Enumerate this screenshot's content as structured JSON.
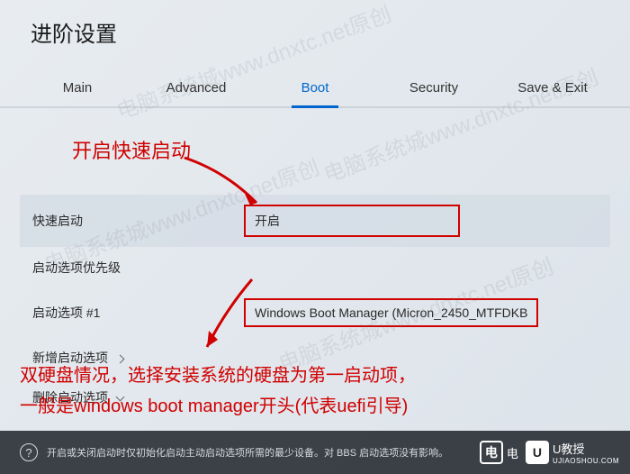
{
  "title": "进阶设置",
  "tabs": {
    "main": "Main",
    "advanced": "Advanced",
    "boot": "Boot",
    "security": "Security",
    "save_exit": "Save & Exit"
  },
  "annotations": {
    "top": "开启快速启动",
    "bottom_line1": "双硬盘情况，选择安装系统的硬盘为第一启动项，",
    "bottom_line2": "一般是windows boot manager开头(代表uefi引导)"
  },
  "settings": {
    "fast_boot": {
      "label": "快速启动",
      "value": "开启"
    },
    "boot_priority": {
      "label": "启动选项优先级"
    },
    "boot_option_1": {
      "label": "启动选项 #1",
      "value": "Windows Boot Manager (Micron_2450_MTFDKB"
    },
    "add_boot": {
      "label": "新增启动选项"
    },
    "delete_boot": {
      "label": "删除启动选项"
    }
  },
  "footer": {
    "help_text": "开启或关闭启动时仅初始化启动主动启动选项所需的最少设备。对 BBS 启动选项没有影响。"
  },
  "watermark": "电脑系统城www.dnxtc.net原创",
  "logos": {
    "left": {
      "icon": "电",
      "text": "电"
    },
    "right": {
      "icon": "U",
      "text": "U教授",
      "sub": "UJIAOSHOU.COM"
    }
  }
}
